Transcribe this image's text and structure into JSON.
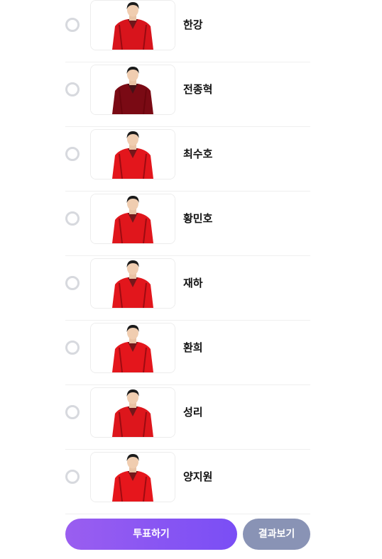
{
  "candidates": [
    {
      "name": "한강",
      "photo": "candidate-photo",
      "outfit_color": "#d8141c"
    },
    {
      "name": "전종혁",
      "photo": "candidate-photo",
      "outfit_color": "#7a0a14"
    },
    {
      "name": "최수호",
      "photo": "candidate-photo",
      "outfit_color": "#e3161c"
    },
    {
      "name": "황민호",
      "photo": "candidate-photo",
      "outfit_color": "#e0161c"
    },
    {
      "name": "재하",
      "photo": "candidate-photo",
      "outfit_color": "#e2161c"
    },
    {
      "name": "환희",
      "photo": "candidate-photo",
      "outfit_color": "#e4161c"
    },
    {
      "name": "성리",
      "photo": "candidate-photo",
      "outfit_color": "#dd161c"
    },
    {
      "name": "양지원",
      "photo": "candidate-photo",
      "outfit_color": "#e6161c"
    }
  ],
  "actions": {
    "vote_label": "투표하기",
    "result_label": "결과보기"
  },
  "colors": {
    "vote_gradient_start": "#9a5ef0",
    "vote_gradient_end": "#7a4ef5",
    "result_bg": "#8993b5",
    "radio_border": "#d7d9de"
  }
}
